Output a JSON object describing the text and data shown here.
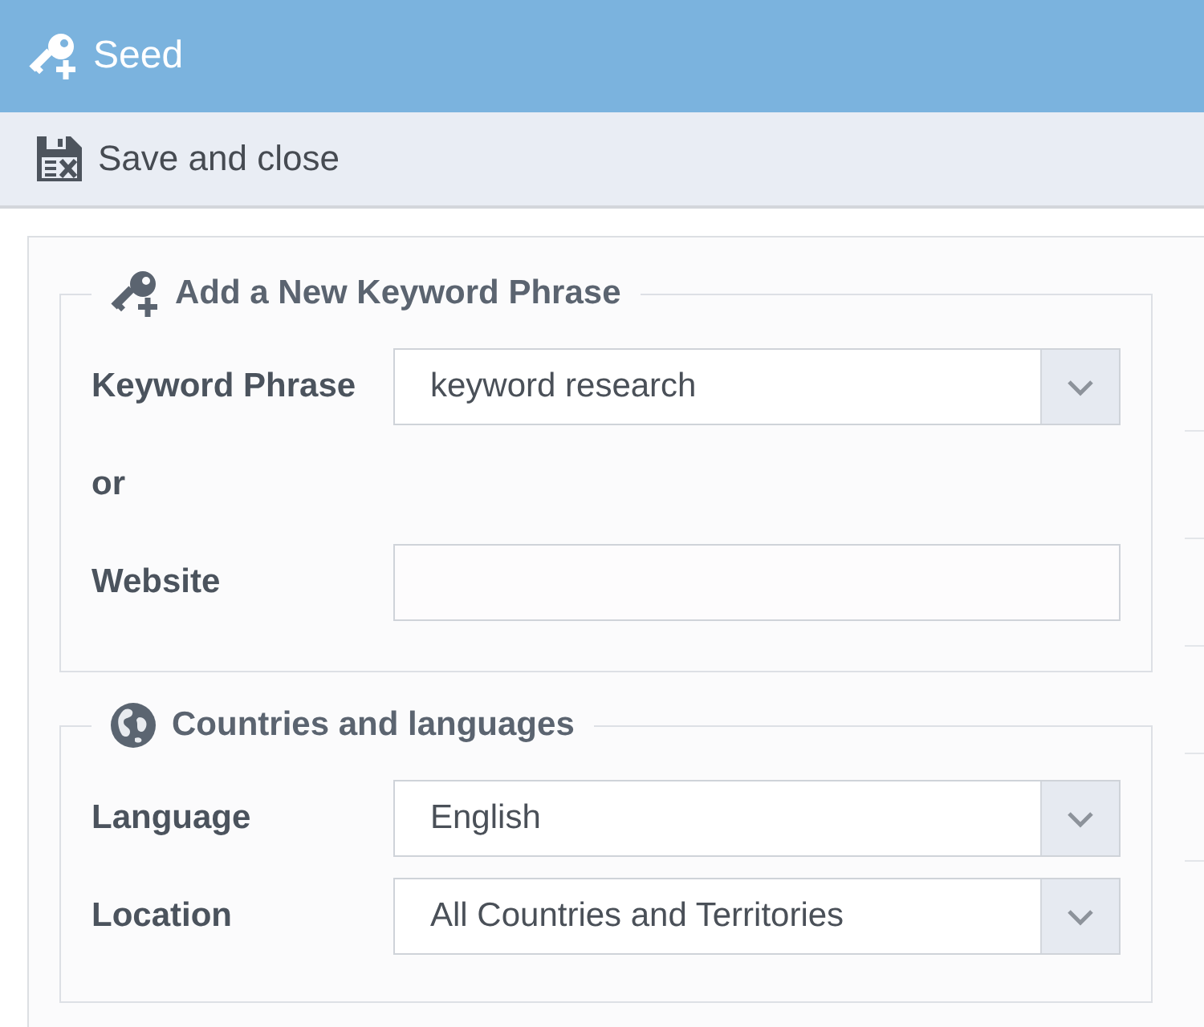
{
  "window": {
    "title": "Seed"
  },
  "toolbar": {
    "buttons": [
      {
        "label": "Save and close"
      }
    ]
  },
  "sections": [
    {
      "title": "Add a New Keyword Phrase",
      "rows": [
        {
          "kind": "dropdown",
          "label": "Keyword Phrase",
          "value": "keyword research"
        },
        {
          "kind": "text",
          "label": "or"
        },
        {
          "kind": "input",
          "label": "Website"
        }
      ]
    },
    {
      "title": "Countries and languages",
      "rows": [
        {
          "kind": "dropdown",
          "label": "Language",
          "value": "English"
        },
        {
          "kind": "dropdown",
          "label": "Location",
          "value": "All Countries and Territories"
        }
      ]
    }
  ]
}
